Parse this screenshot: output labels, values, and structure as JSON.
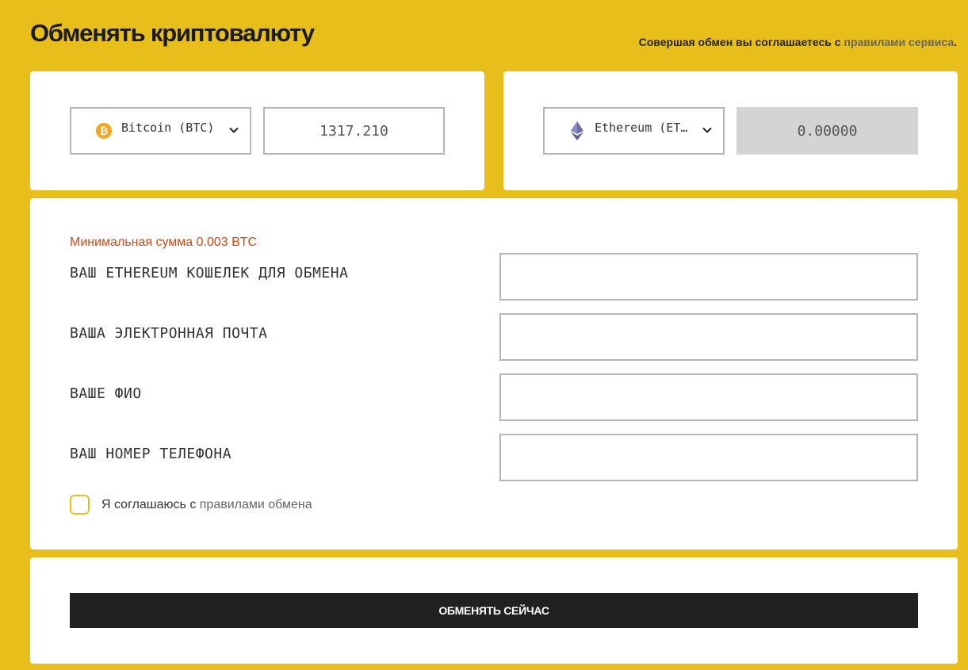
{
  "header": {
    "title": "Обменять криптовалюту",
    "rules_prefix": "Совершая обмен вы соглашаетесь с ",
    "rules_link": "правилами сервиса",
    "rules_suffix": "."
  },
  "from": {
    "currency": "Bitcoin (BTC)",
    "icon": "bitcoin-icon",
    "amount": "1317.210"
  },
  "to": {
    "currency": "Ethereum (ETH)",
    "icon": "ethereum-icon",
    "amount": "0.00000"
  },
  "form": {
    "min_note": "Минимальная сумма 0.003 BTC",
    "fields": [
      {
        "label": "ВАШ ETHEREUM КОШЕЛЕК ДЛЯ ОБМЕНА",
        "value": ""
      },
      {
        "label": "ВАША ЭЛЕКТРОННАЯ ПОЧТА",
        "value": ""
      },
      {
        "label": "ВАШЕ ФИО",
        "value": ""
      },
      {
        "label": "ВАШ НОМЕР ТЕЛЕФОНА",
        "value": ""
      }
    ],
    "agree_prefix": "Я соглашаюсь с ",
    "agree_link": "правилами обмена"
  },
  "submit": {
    "label": "ОБМЕНЯТЬ СЕЙЧАС"
  },
  "colors": {
    "background": "#e8bf1a",
    "button": "#212121",
    "warning": "#cc4a14",
    "bitcoin": "#f2a51d",
    "ethereum": "#6b6fa0"
  }
}
